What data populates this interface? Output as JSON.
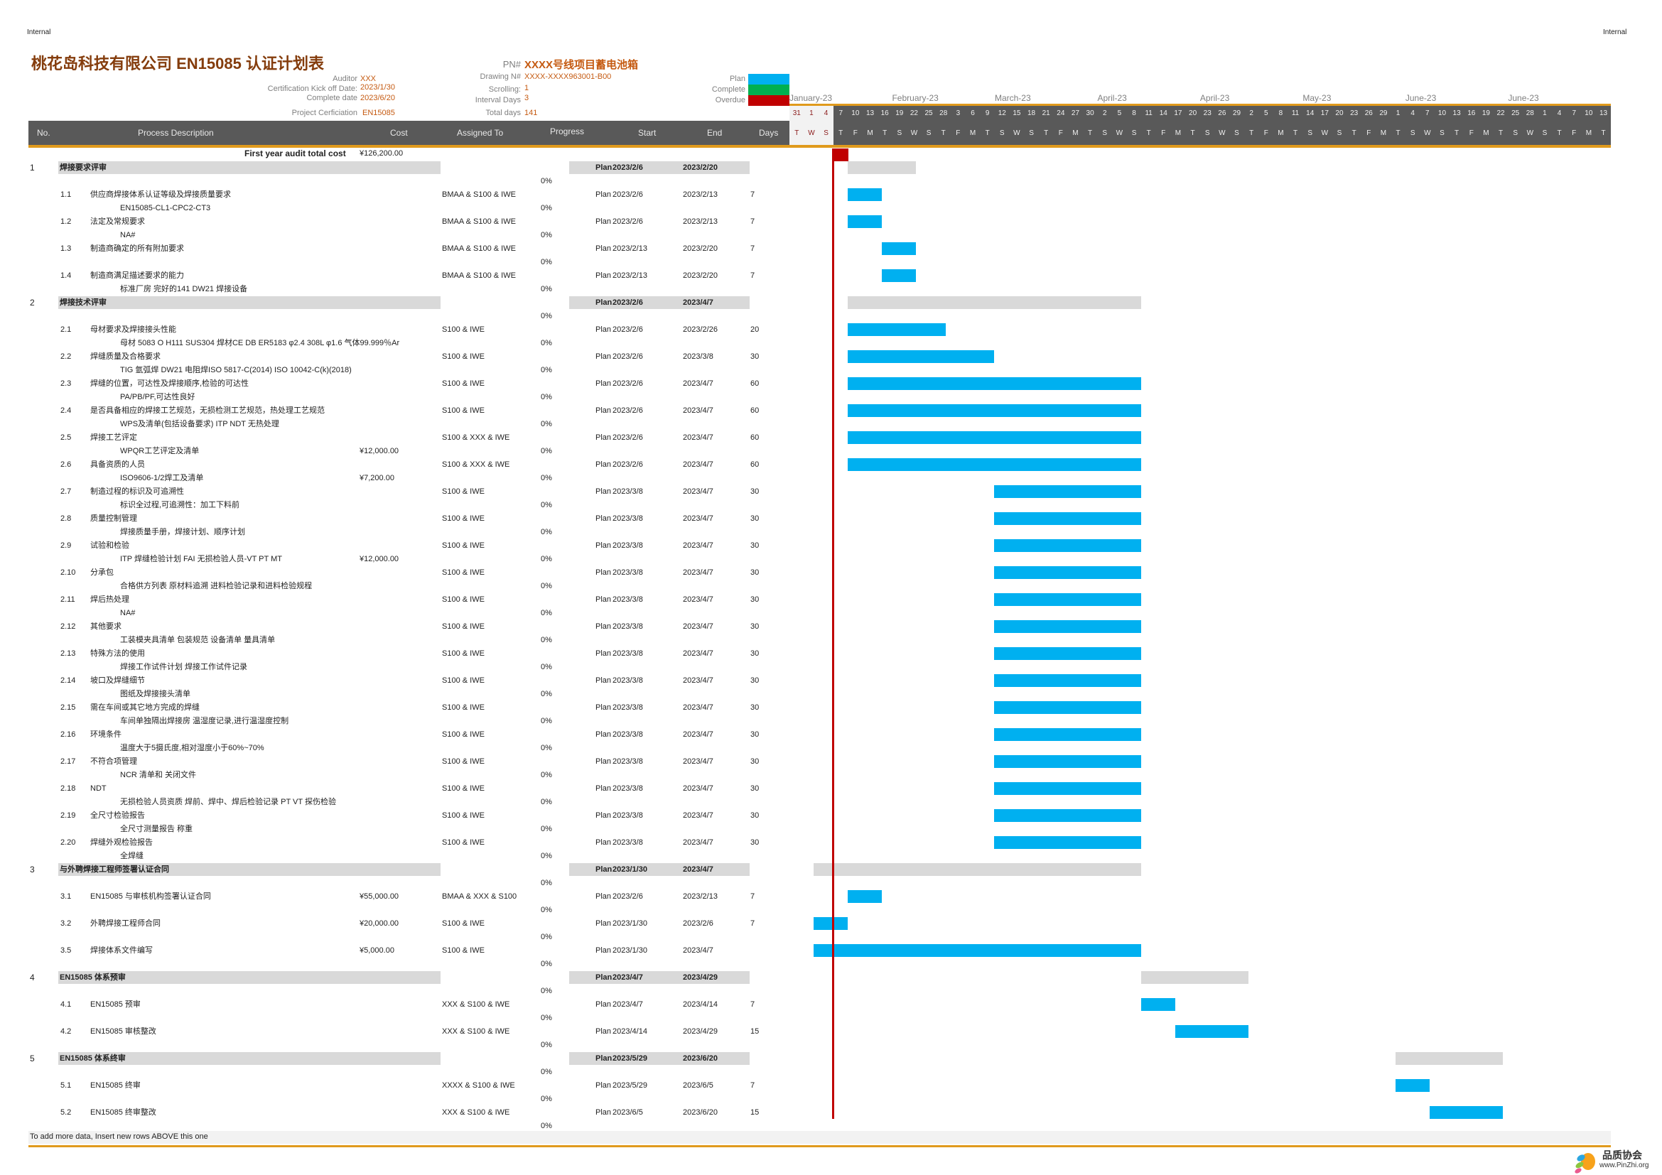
{
  "page_marks": {
    "left": "Internal",
    "right": "Internal"
  },
  "title": "桃花岛科技有限公司 EN15085 认证计划表",
  "meta": {
    "auditor_label": "Auditor",
    "auditor": "XXX",
    "kickoff_label": "Certification Kick off Date:",
    "kickoff": "2023/1/30",
    "complete_label": "Complete date",
    "complete": "2023/6/20",
    "project_label": "Project Cerficiation",
    "project": "EN15085",
    "pn_label": "PN#",
    "pn": "XXXX号线项目蓄电池箱",
    "drawing_label": "Drawing N#",
    "drawing": "XXXX-XXXX963001-B00",
    "scrolling_label": "Scrolling:",
    "scrolling": "1",
    "interval_label": "Interval Days",
    "interval": "3",
    "total_label": "Total days",
    "total": "141"
  },
  "legend": [
    {
      "label": "Plan",
      "color": "#00b0f0"
    },
    {
      "label": "Complete",
      "color": "#00b050"
    },
    {
      "label": "Overdue",
      "color": "#c00000"
    }
  ],
  "columns": {
    "no": "No.",
    "desc": "Process Description",
    "cost": "Cost",
    "assigned": "Assigned To",
    "progress": "Progress",
    "start": "Start",
    "end": "End",
    "days": "Days"
  },
  "timeline": {
    "months": [
      "January-23",
      "February-23",
      "March-23",
      "April-23",
      "April-23",
      "May-23",
      "June-23",
      "June-23"
    ],
    "day_numbers": [
      "31",
      "1",
      "4",
      "7",
      "10",
      "13",
      "16",
      "19",
      "22",
      "25",
      "28",
      "3",
      "6",
      "9",
      "12",
      "15",
      "18",
      "21",
      "24",
      "27",
      "30",
      "2",
      "5",
      "8",
      "11",
      "14",
      "17",
      "20",
      "23",
      "26",
      "29",
      "2",
      "5",
      "8",
      "11",
      "14",
      "17",
      "20",
      "23",
      "26",
      "29",
      "1",
      "4",
      "7",
      "10",
      "13",
      "16",
      "19",
      "22",
      "25",
      "28",
      "1",
      "4",
      "7",
      "10",
      "13"
    ],
    "weekdays": [
      "T",
      "W",
      "S",
      "T",
      "F",
      "M",
      "T",
      "S",
      "W",
      "S",
      "T",
      "F",
      "M",
      "T",
      "S",
      "W",
      "S",
      "T",
      "F",
      "M",
      "T",
      "S",
      "W",
      "S",
      "T",
      "F",
      "M",
      "T",
      "S",
      "W",
      "S",
      "T",
      "F",
      "M",
      "T",
      "S",
      "W",
      "S",
      "T",
      "F",
      "M",
      "T",
      "S",
      "W",
      "S",
      "T",
      "F",
      "M",
      "T",
      "S",
      "W",
      "S",
      "T",
      "F",
      "M",
      "T"
    ],
    "today": "2023/2/6",
    "plan_color": "#00b0f0",
    "group_color": "#d9d9d9",
    "today_color": "#c00000"
  },
  "total_cost_label": "First year audit total cost",
  "total_cost": "¥126,200.00",
  "rows": [
    {
      "type": "group",
      "no": "1",
      "label": "焊接要求评审",
      "status": "Plan",
      "start": "2023/2/6",
      "end": "2023/2/20",
      "progress": "0%"
    },
    {
      "type": "task",
      "no": "1.1",
      "label": "供应商焊接体系认证等级及焊接质量要求",
      "detail": "EN15085-CL1-CPC2-CT3",
      "assigned": "BMAA &  S100 & IWE",
      "status": "Plan",
      "start": "2023/2/6",
      "end": "2023/2/13",
      "days": "7",
      "progress": "0%"
    },
    {
      "type": "task",
      "no": "1.2",
      "label": "法定及常规要求",
      "detail": "NA#",
      "assigned": "BMAA &  S100 & IWE",
      "status": "Plan",
      "start": "2023/2/6",
      "end": "2023/2/13",
      "days": "7",
      "progress": "0%"
    },
    {
      "type": "task",
      "no": "1.3",
      "label": "制造商确定的所有附加要求",
      "detail": "",
      "assigned": "BMAA &  S100 & IWE",
      "status": "Plan",
      "start": "2023/2/13",
      "end": "2023/2/20",
      "days": "7",
      "progress": "0%"
    },
    {
      "type": "task",
      "no": "1.4",
      "label": "制造商满足描述要求的能力",
      "detail": "标准厂房 完好的141 DW21 焊接设备",
      "assigned": "BMAA &  S100 & IWE",
      "status": "Plan",
      "start": "2023/2/13",
      "end": "2023/2/20",
      "days": "7",
      "progress": "0%"
    },
    {
      "type": "group",
      "no": "2",
      "label": "焊接技术评审",
      "status": "Plan",
      "start": "2023/2/6",
      "end": "2023/4/7",
      "progress": "0%"
    },
    {
      "type": "task",
      "no": "2.1",
      "label": "母材要求及焊接接头性能",
      "detail": "母材 5083 O H111 SUS304 焊材CE DB  ER5183 φ2.4 308L φ1.6 气体99.999％Ar",
      "assigned": "S100 & IWE",
      "status": "Plan",
      "start": "2023/2/6",
      "end": "2023/2/26",
      "days": "20",
      "progress": "0%"
    },
    {
      "type": "task",
      "no": "2.2",
      "label": "焊缝质量及合格要求",
      "detail": "TIG 氩弧焊  DW21 电阻焊ISO 5817-C(2014) ISO 10042-C(k)(2018)",
      "assigned": "S100 & IWE",
      "status": "Plan",
      "start": "2023/2/6",
      "end": "2023/3/8",
      "days": "30",
      "progress": "0%"
    },
    {
      "type": "task",
      "no": "2.3",
      "label": "焊缝的位置，可达性及焊接顺序,检验的可达性",
      "detail": "PA/PB/PF,可达性良好",
      "assigned": "S100 & IWE",
      "status": "Plan",
      "start": "2023/2/6",
      "end": "2023/4/7",
      "days": "60",
      "progress": "0%"
    },
    {
      "type": "task",
      "no": "2.4",
      "label": "是否具备相应的焊接工艺规范，无损检测工艺规范，热处理工艺规范",
      "detail": "WPS及清单(包括设备要求) ITP NDT 无热处理",
      "assigned": "S100 & IWE",
      "status": "Plan",
      "start": "2023/2/6",
      "end": "2023/4/7",
      "days": "60",
      "progress": "0%"
    },
    {
      "type": "task",
      "no": "2.5",
      "label": "焊接工艺评定",
      "detail": "WPQR工艺评定及清单",
      "cost": "¥12,000.00",
      "assigned": "S100 & XXX & IWE",
      "status": "Plan",
      "start": "2023/2/6",
      "end": "2023/4/7",
      "days": "60",
      "progress": "0%"
    },
    {
      "type": "task",
      "no": "2.6",
      "label": "具备资质的人员",
      "detail": "ISO9606-1/2焊工及清单",
      "cost": "¥7,200.00",
      "assigned": "S100 & XXX & IWE",
      "status": "Plan",
      "start": "2023/2/6",
      "end": "2023/4/7",
      "days": "60",
      "progress": "0%"
    },
    {
      "type": "task",
      "no": "2.7",
      "label": "制造过程的标识及可追溯性",
      "detail": "标识全过程,可追溯性：加工下料前",
      "assigned": "S100 & IWE",
      "status": "Plan",
      "start": "2023/3/8",
      "end": "2023/4/7",
      "days": "30",
      "progress": "0%"
    },
    {
      "type": "task",
      "no": "2.8",
      "label": "质量控制管理",
      "detail": "焊接质量手册，焊接计划、顺序计划",
      "assigned": "S100 & IWE",
      "status": "Plan",
      "start": "2023/3/8",
      "end": "2023/4/7",
      "days": "30",
      "progress": "0%"
    },
    {
      "type": "task",
      "no": "2.9",
      "label": "试验和检验",
      "detail": "ITP 焊缝检验计划  FAI 无损检验人员-VT PT MT",
      "cost": "¥12,000.00",
      "assigned": "S100 & IWE",
      "status": "Plan",
      "start": "2023/3/8",
      "end": "2023/4/7",
      "days": "30",
      "progress": "0%"
    },
    {
      "type": "task",
      "no": "2.10",
      "label": "分承包",
      "detail": "合格供方列表 原材料追溯 进料检验记录和进料检验规程",
      "assigned": "S100 & IWE",
      "status": "Plan",
      "start": "2023/3/8",
      "end": "2023/4/7",
      "days": "30",
      "progress": "0%"
    },
    {
      "type": "task",
      "no": "2.11",
      "label": "焊后热处理",
      "detail": "NA#",
      "assigned": "S100 & IWE",
      "status": "Plan",
      "start": "2023/3/8",
      "end": "2023/4/7",
      "days": "30",
      "progress": "0%"
    },
    {
      "type": "task",
      "no": "2.12",
      "label": "其他要求",
      "detail": "工装模夹具清单 包装规范 设备清单 量具清单",
      "assigned": "S100 & IWE",
      "status": "Plan",
      "start": "2023/3/8",
      "end": "2023/4/7",
      "days": "30",
      "progress": "0%"
    },
    {
      "type": "task",
      "no": "2.13",
      "label": "特殊方法的使用",
      "detail": "焊接工作试件计划 焊接工作试件记录",
      "assigned": "S100 & IWE",
      "status": "Plan",
      "start": "2023/3/8",
      "end": "2023/4/7",
      "days": "30",
      "progress": "0%"
    },
    {
      "type": "task",
      "no": "2.14",
      "label": "坡口及焊缝细节",
      "detail": "图纸及焊接接头清单",
      "assigned": "S100 & IWE",
      "status": "Plan",
      "start": "2023/3/8",
      "end": "2023/4/7",
      "days": "30",
      "progress": "0%"
    },
    {
      "type": "task",
      "no": "2.15",
      "label": "需在车间或其它地方完成的焊缝",
      "detail": "车间单独隔出焊接房  温湿度记录,进行温湿度控制",
      "assigned": "S100 & IWE",
      "status": "Plan",
      "start": "2023/3/8",
      "end": "2023/4/7",
      "days": "30",
      "progress": "0%"
    },
    {
      "type": "task",
      "no": "2.16",
      "label": "环境条件",
      "detail": "温度大于5摄氏度,相对湿度小于60%~70%",
      "assigned": "S100 & IWE",
      "status": "Plan",
      "start": "2023/3/8",
      "end": "2023/4/7",
      "days": "30",
      "progress": "0%"
    },
    {
      "type": "task",
      "no": "2.17",
      "label": "不符合项管理",
      "detail": "NCR 清单和 关闭文件",
      "assigned": "S100 & IWE",
      "status": "Plan",
      "start": "2023/3/8",
      "end": "2023/4/7",
      "days": "30",
      "progress": "0%"
    },
    {
      "type": "task",
      "no": "2.18",
      "label": "NDT",
      "detail": "无损检验人员资质 焊前、焊中、焊后检验记录 PT VT 探伤检验",
      "assigned": "S100 & IWE",
      "status": "Plan",
      "start": "2023/3/8",
      "end": "2023/4/7",
      "days": "30",
      "progress": "0%"
    },
    {
      "type": "task",
      "no": "2.19",
      "label": "全尺寸检验报告",
      "detail": "全尺寸测量报告 称重",
      "assigned": "S100 & IWE",
      "status": "Plan",
      "start": "2023/3/8",
      "end": "2023/4/7",
      "days": "30",
      "progress": "0%"
    },
    {
      "type": "task",
      "no": "2.20",
      "label": "焊缝外观检验报告",
      "detail": "全焊缝",
      "assigned": "S100 & IWE",
      "status": "Plan",
      "start": "2023/3/8",
      "end": "2023/4/7",
      "days": "30",
      "progress": "0%"
    },
    {
      "type": "group",
      "no": "3",
      "label": "与外聘焊接工程师签署认证合同",
      "status": "Plan",
      "start": "2023/1/30",
      "end": "2023/4/7",
      "progress": "0%"
    },
    {
      "type": "task",
      "no": "3.1",
      "label": "EN15085 与审核机构签署认证合同",
      "detail": "",
      "cost": "¥55,000.00",
      "assigned": "BMAA & XXX & S100",
      "status": "Plan",
      "start": "2023/2/6",
      "end": "2023/2/13",
      "days": "7",
      "progress": "0%"
    },
    {
      "type": "task",
      "no": "3.2",
      "label": "外聘焊接工程师合同",
      "detail": "",
      "cost": "¥20,000.00",
      "assigned": "S100 & IWE",
      "status": "Plan",
      "start": "2023/1/30",
      "end": "2023/2/6",
      "days": "7",
      "progress": "0%"
    },
    {
      "type": "task",
      "no": "3.5",
      "label": "焊接体系文件编写",
      "detail": "",
      "cost": "¥5,000.00",
      "assigned": "S100 & IWE",
      "status": "Plan",
      "start": "2023/1/30",
      "end": "2023/4/7",
      "days": "",
      "progress": "0%"
    },
    {
      "type": "group",
      "no": "4",
      "label": "EN15085 体系预审",
      "status": "Plan",
      "start": "2023/4/7",
      "end": "2023/4/29",
      "progress": "0%"
    },
    {
      "type": "task",
      "no": "4.1",
      "label": "EN15085 预审",
      "detail": "",
      "assigned": "XXX & S100 & IWE",
      "status": "Plan",
      "start": "2023/4/7",
      "end": "2023/4/14",
      "days": "7",
      "progress": "0%"
    },
    {
      "type": "task",
      "no": "4.2",
      "label": "EN15085 审核整改",
      "detail": "",
      "assigned": "XXX & S100 & IWE",
      "status": "Plan",
      "start": "2023/4/14",
      "end": "2023/4/29",
      "days": "15",
      "progress": "0%"
    },
    {
      "type": "group",
      "no": "5",
      "label": "EN15085 体系终审",
      "status": "Plan",
      "start": "2023/5/29",
      "end": "2023/6/20",
      "progress": "0%"
    },
    {
      "type": "task",
      "no": "5.1",
      "label": "EN15085 终审",
      "detail": "",
      "assigned": "XXXX & S100 & IWE",
      "status": "Plan",
      "start": "2023/5/29",
      "end": "2023/6/5",
      "days": "7",
      "progress": "0%"
    },
    {
      "type": "task",
      "no": "5.2",
      "label": "EN15085 终审整改",
      "detail": "",
      "assigned": "XXX & S100 & IWE",
      "status": "Plan",
      "start": "2023/6/5",
      "end": "2023/6/20",
      "days": "15",
      "progress": "0%"
    }
  ],
  "footer_note": "To add more data, Insert new rows ABOVE this one",
  "watermark": {
    "name": "品质协会",
    "url": "www.PinZhi.org"
  }
}
